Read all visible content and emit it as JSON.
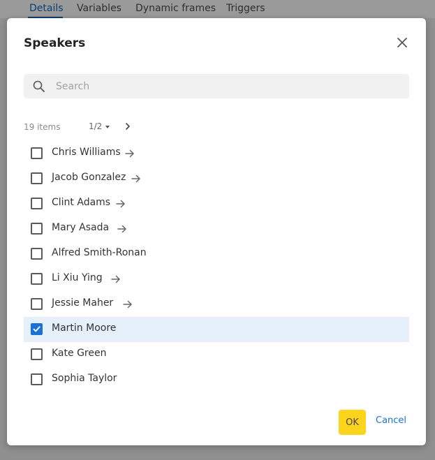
{
  "background_tabs": [
    {
      "label": "Details",
      "active": true
    },
    {
      "label": "Variables",
      "active": false
    },
    {
      "label": "Dynamic frames",
      "active": false
    },
    {
      "label": "Triggers",
      "active": false
    }
  ],
  "dialog": {
    "title": "Speakers",
    "close_icon": "close-icon"
  },
  "search": {
    "placeholder": "Search",
    "value": "",
    "icon": "search-icon"
  },
  "pagination": {
    "items_count": "19 items",
    "page": "1/2",
    "next_icon": "chevron-right-icon"
  },
  "speakers": [
    {
      "name": "Chris Williams",
      "checked": false,
      "has_arrow": true
    },
    {
      "name": "Jacob Gonzalez",
      "checked": false,
      "has_arrow": true
    },
    {
      "name": "Clint Adams",
      "checked": false,
      "has_arrow": true
    },
    {
      "name": "Mary Asada",
      "checked": false,
      "has_arrow": true
    },
    {
      "name": "Alfred Smith-Ronan",
      "checked": false,
      "has_arrow": false
    },
    {
      "name": "Li Xiu Ying",
      "checked": false,
      "has_arrow": true
    },
    {
      "name": "Jessie Maher",
      "checked": false,
      "has_arrow": true
    },
    {
      "name": "Martin Moore",
      "checked": true,
      "has_arrow": false
    },
    {
      "name": "Kate Green",
      "checked": false,
      "has_arrow": false
    },
    {
      "name": "Sophia Taylor",
      "checked": false,
      "has_arrow": false
    }
  ],
  "footer": {
    "ok_label": "OK",
    "cancel_label": "Cancel"
  },
  "colors": {
    "accent": "#1a73d4",
    "primary_button": "#fcd41c",
    "selected_row": "#e6f0fb"
  }
}
